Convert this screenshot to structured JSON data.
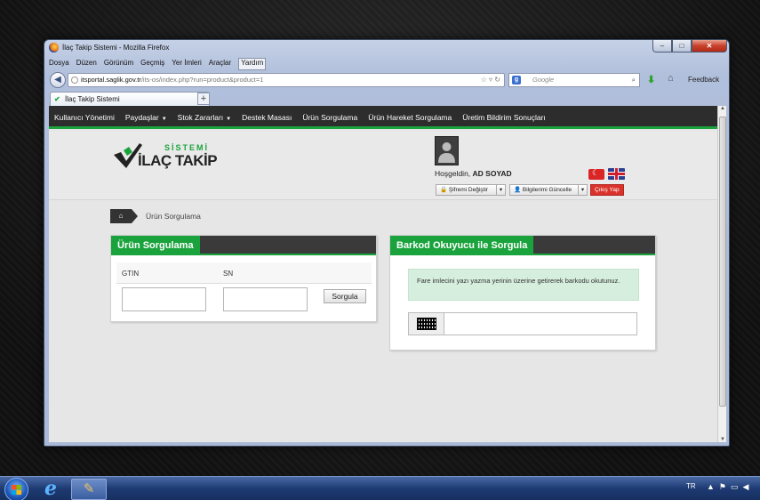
{
  "window": {
    "title": "İlaç Takip Sistemi - Mozilla Firefox",
    "controls": {
      "minimize": "–",
      "maximize": "□",
      "close": "✕"
    }
  },
  "menubar": [
    "Dosya",
    "Düzen",
    "Görünüm",
    "Geçmiş",
    "Yer İmleri",
    "Araçlar",
    "Yardım"
  ],
  "navbar": {
    "url_domain": "itsportal.saglik.gov.tr",
    "url_path": "/its-os/index.php?run=product&product=1",
    "url_prefix": "",
    "search_placeholder": "Google",
    "feedback": "Feedback"
  },
  "tabs": [
    {
      "label": "İlaç Takip Sistemi"
    }
  ],
  "site_nav": {
    "items": [
      {
        "label": "Kullanıcı Yönetimi",
        "dropdown": false
      },
      {
        "label": "Paydaşlar",
        "dropdown": true
      },
      {
        "label": "Stok Zararları",
        "dropdown": true
      },
      {
        "label": "Destek Masası",
        "dropdown": false
      },
      {
        "label": "Ürün Sorgulama",
        "dropdown": false
      },
      {
        "label": "Ürün Hareket Sorgulama",
        "dropdown": false
      },
      {
        "label": "Üretim Bildirim Sonuçları",
        "dropdown": false
      }
    ]
  },
  "logo": {
    "top": "SİSTEMİ",
    "main": "İLAÇ TAKİP"
  },
  "user": {
    "welcome_prefix": "Hoşgeldin,",
    "name": "AD SOYAD",
    "change_password": "Şifremi Değiştir",
    "update_info": "Bilgilerimi Güncelle",
    "logout": "Çıkış Yap"
  },
  "breadcrumb": {
    "current": "Ürün Sorgulama"
  },
  "product_query": {
    "title": "Ürün Sorgulama",
    "gtin_label": "GTIN",
    "sn_label": "SN",
    "gtin_value": "",
    "sn_value": "",
    "button": "Sorgula"
  },
  "barcode_query": {
    "title": "Barkod Okuyucu ile Sorgula",
    "info": "Fare imlecini yazı yazma yerinin üzerine getirerek barkodu okutunuz.",
    "value": ""
  },
  "taskbar": {
    "lang": "TR"
  },
  "colors": {
    "accent": "#1aa33c",
    "nav_bg": "#2d2d2d",
    "logout": "#d9332b"
  }
}
